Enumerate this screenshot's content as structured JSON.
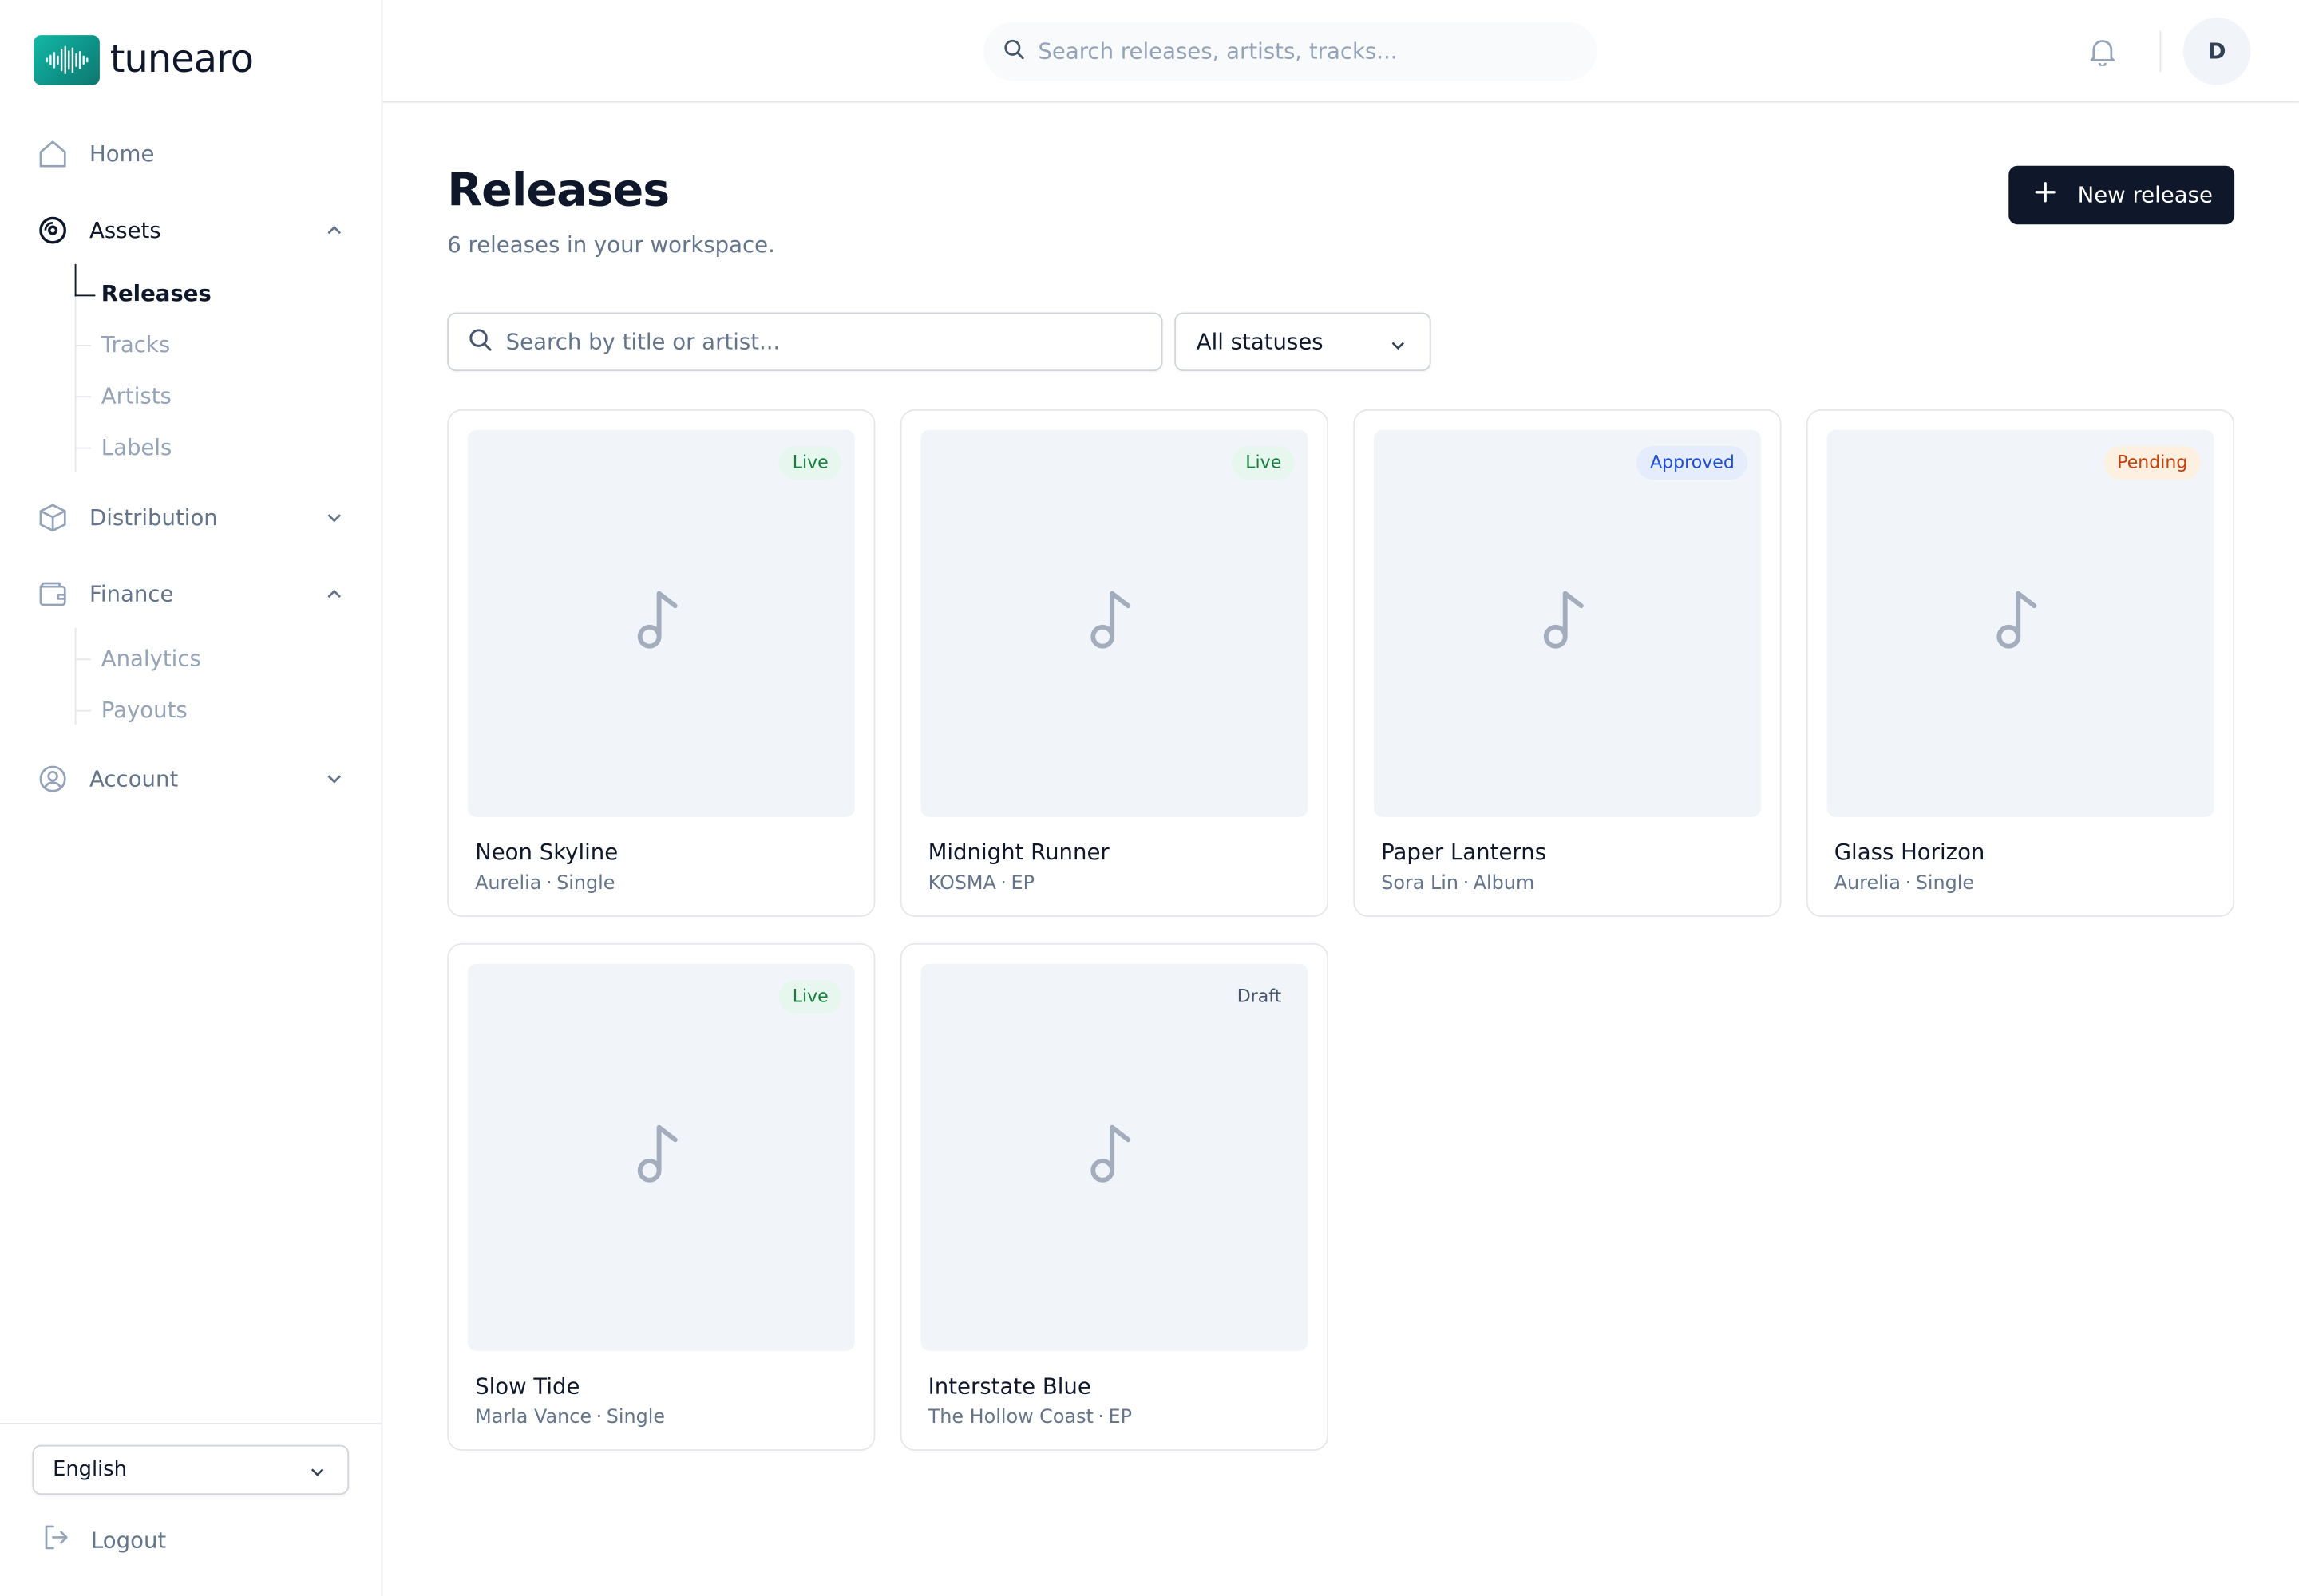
{
  "app": {
    "name": "tunearo"
  },
  "sidebar": {
    "nav": [
      {
        "label": "Home",
        "icon": "home-icon"
      },
      {
        "label": "Assets",
        "icon": "disc-icon"
      },
      {
        "label": "Distribution",
        "icon": "package-icon"
      },
      {
        "label": "Finance",
        "icon": "wallet-icon"
      },
      {
        "label": "Account",
        "icon": "user-circle-icon"
      }
    ],
    "assets_sub": [
      "Releases",
      "Tracks",
      "Artists",
      "Labels"
    ],
    "finance_sub": [
      "Analytics",
      "Payouts"
    ],
    "language": "English",
    "logout": "Logout"
  },
  "topbar": {
    "search_placeholder": "Search releases, artists, tracks...",
    "avatar_initial": "D"
  },
  "main": {
    "title": "Releases",
    "subtitle": "6 releases in your workspace.",
    "new_button": "New release",
    "filter_placeholder": "Search by title or artist...",
    "status_filter": "All statuses"
  },
  "status_colors": {
    "Live": {
      "bg": "#e7f6ee",
      "fg": "#15803d"
    },
    "Approved": {
      "bg": "#e5edfd",
      "fg": "#1d4ed8"
    },
    "Pending": {
      "bg": "#fdf0e1",
      "fg": "#c2410c"
    },
    "Draft": {
      "bg": "#f1f5f9",
      "fg": "#475569"
    }
  },
  "releases": [
    {
      "title": "Neon Skyline",
      "artist": "Aurelia",
      "type": "Single",
      "status": "Live"
    },
    {
      "title": "Midnight Runner",
      "artist": "KOSMA",
      "type": "EP",
      "status": "Live"
    },
    {
      "title": "Paper Lanterns",
      "artist": "Sora Lin",
      "type": "Album",
      "status": "Approved"
    },
    {
      "title": "Glass Horizon",
      "artist": "Aurelia",
      "type": "Single",
      "status": "Pending"
    },
    {
      "title": "Slow Tide",
      "artist": "Marla Vance",
      "type": "Single",
      "status": "Live"
    },
    {
      "title": "Interstate Blue",
      "artist": "The Hollow Coast",
      "type": "EP",
      "status": "Draft"
    }
  ]
}
